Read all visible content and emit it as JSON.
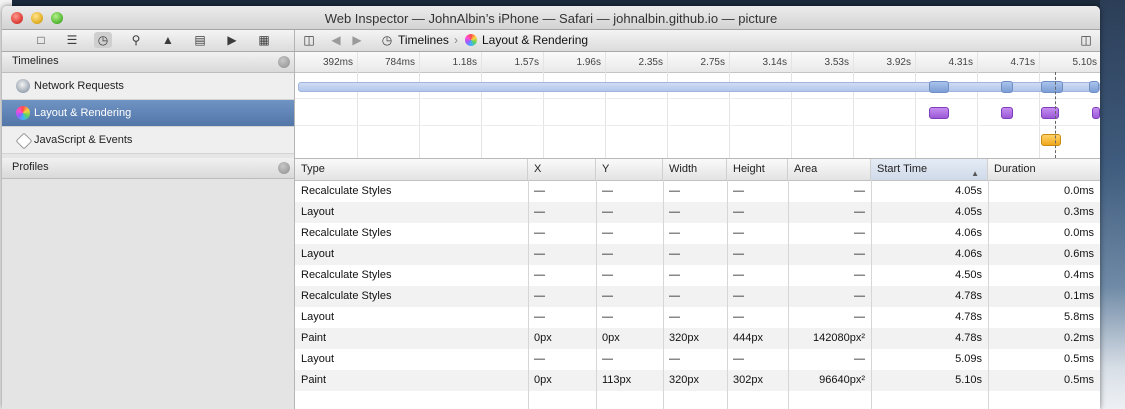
{
  "window": {
    "title": "Web Inspector — JohnAlbin’s iPhone — Safari — johnalbin.github.io — picture"
  },
  "toolbar": {
    "icons": [
      "resources-icon",
      "storage-icon",
      "timelines-icon",
      "search-icon",
      "issues-icon",
      "debugger-icon",
      "log-icon",
      "console-icon"
    ],
    "breadcrumbs": [
      "Timelines",
      "Layout & Rendering"
    ]
  },
  "sidebar": {
    "timelines_header": "Timelines",
    "items": [
      {
        "label": "Network Requests",
        "icon": "network-icon"
      },
      {
        "label": "Layout & Rendering",
        "icon": "layout-rendering-icon",
        "selected": true
      },
      {
        "label": "JavaScript & Events",
        "icon": "javascript-events-icon"
      }
    ],
    "profiles_header": "Profiles"
  },
  "timeline": {
    "ticks": [
      "392ms",
      "784ms",
      "1.18s",
      "1.57s",
      "1.96s",
      "2.35s",
      "2.75s",
      "3.14s",
      "3.53s",
      "3.92s",
      "4.31s",
      "4.71s",
      "5.10s"
    ],
    "colors": {
      "network": "#7d9ed6",
      "layout": "#9a59d6",
      "javascript": "#f0a81c"
    }
  },
  "table": {
    "columns": [
      "Type",
      "X",
      "Y",
      "Width",
      "Height",
      "Area",
      "Start Time",
      "Duration"
    ],
    "sorted_column": "Start Time",
    "rows": [
      [
        "Recalculate Styles",
        "—",
        "—",
        "—",
        "—",
        "—",
        "4.05s",
        "0.0ms"
      ],
      [
        "Layout",
        "—",
        "—",
        "—",
        "—",
        "—",
        "4.05s",
        "0.3ms"
      ],
      [
        "Recalculate Styles",
        "—",
        "—",
        "—",
        "—",
        "—",
        "4.06s",
        "0.0ms"
      ],
      [
        "Layout",
        "—",
        "—",
        "—",
        "—",
        "—",
        "4.06s",
        "0.6ms"
      ],
      [
        "Recalculate Styles",
        "—",
        "—",
        "—",
        "—",
        "—",
        "4.50s",
        "0.4ms"
      ],
      [
        "Recalculate Styles",
        "—",
        "—",
        "—",
        "—",
        "—",
        "4.78s",
        "0.1ms"
      ],
      [
        "Layout",
        "—",
        "—",
        "—",
        "—",
        "—",
        "4.78s",
        "5.8ms"
      ],
      [
        "Paint",
        "0px",
        "0px",
        "320px",
        "444px",
        "142080px²",
        "4.78s",
        "0.2ms"
      ],
      [
        "Layout",
        "—",
        "—",
        "—",
        "—",
        "—",
        "5.09s",
        "0.5ms"
      ],
      [
        "Paint",
        "0px",
        "113px",
        "320px",
        "302px",
        "96640px²",
        "5.10s",
        "0.5ms"
      ]
    ]
  }
}
